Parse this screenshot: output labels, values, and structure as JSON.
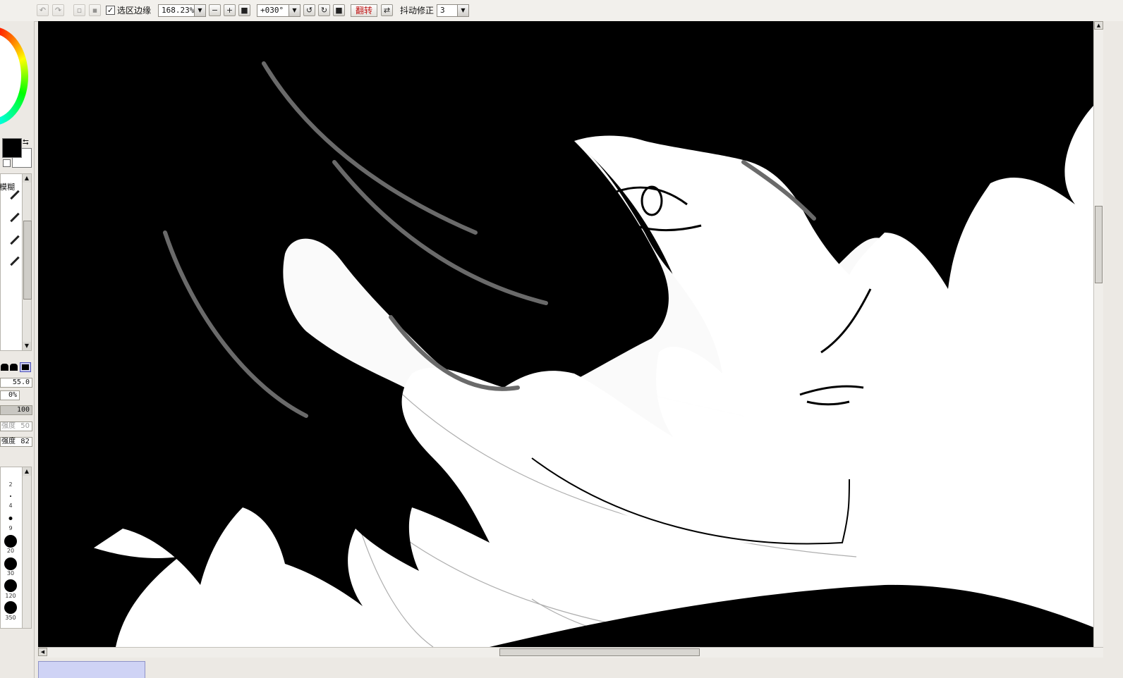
{
  "toolbar": {
    "selection_edge_label": "选区边缘",
    "selection_edge_checked": "✓",
    "zoom_value": "168.23%",
    "rotation_value": "+030°",
    "flip_label": "翻转",
    "stabilizer_label": "抖动修正",
    "stabilizer_value": "3"
  },
  "left_panel": {
    "tool_label": "模糊",
    "brush_size": "55.0",
    "min_size": "0%",
    "density": "100",
    "field_a_label": "强度",
    "field_a_value": "50",
    "field_b_label": "强度",
    "field_b_value": "82",
    "brush_sizes": [
      "2",
      "4",
      "9",
      "20",
      "30",
      "120",
      "350"
    ]
  },
  "colors": {
    "foreground": "#000000",
    "background": "#ffffff",
    "flip_text": "#c01414",
    "doc_tab": "#cfd3f5"
  },
  "icons": [
    "undo-icon",
    "redo-icon",
    "zoom-out-icon",
    "zoom-in-icon",
    "zoom-reset-icon",
    "rotate-ccw-icon",
    "rotate-cw-icon",
    "rotate-reset-icon",
    "swap-colors-icon",
    "pen-icon"
  ]
}
